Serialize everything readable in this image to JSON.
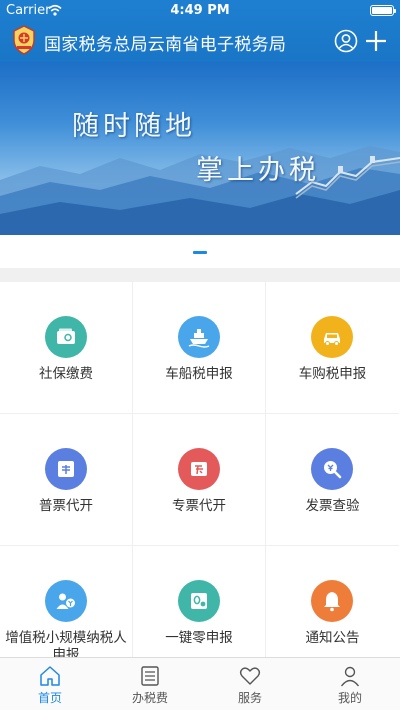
{
  "status_bar": {
    "carrier": "Carrier",
    "time": "4:49 PM"
  },
  "header": {
    "title": "国家税务总局云南省电子税务局",
    "logo_icon": "tax-emblem-icon",
    "user_icon": "user-icon",
    "add_icon": "plus-icon"
  },
  "banner": {
    "slogan_line1": "随时随地",
    "slogan_line2": "掌上办税",
    "current_slide": 1
  },
  "services": [
    {
      "label": "社保缴费",
      "icon": "wallet-icon",
      "color": "#3fb6a8"
    },
    {
      "label": "车船税申报",
      "icon": "boat-icon",
      "color": "#4aa6ea"
    },
    {
      "label": "车购税申报",
      "icon": "car-icon",
      "color": "#f2b21b"
    },
    {
      "label": "普票代开",
      "icon": "invoice-icon",
      "color": "#5b7fe0"
    },
    {
      "label": "专票代开",
      "icon": "special-invoice-icon",
      "color": "#e45a5a"
    },
    {
      "label": "发票查验",
      "icon": "search-invoice-icon",
      "color": "#5b7fe0"
    },
    {
      "label": "增值税小规模纳税人申报",
      "icon": "person-tax-icon",
      "color": "#4aa6ea"
    },
    {
      "label": "一键零申报",
      "icon": "zero-report-icon",
      "color": "#3fb6a8"
    },
    {
      "label": "通知公告",
      "icon": "bell-icon",
      "color": "#ef7d3a"
    }
  ],
  "tabbar": {
    "tabs": [
      {
        "label": "首页",
        "icon": "home-icon",
        "active": true
      },
      {
        "label": "办税费",
        "icon": "list-icon",
        "active": false
      },
      {
        "label": "服务",
        "icon": "heart-icon",
        "active": false
      },
      {
        "label": "我的",
        "icon": "profile-icon",
        "active": false
      }
    ]
  },
  "colors": {
    "primary": "#1e7fd0",
    "tab_active": "#1e88e5",
    "background": "#f0f0f0"
  }
}
